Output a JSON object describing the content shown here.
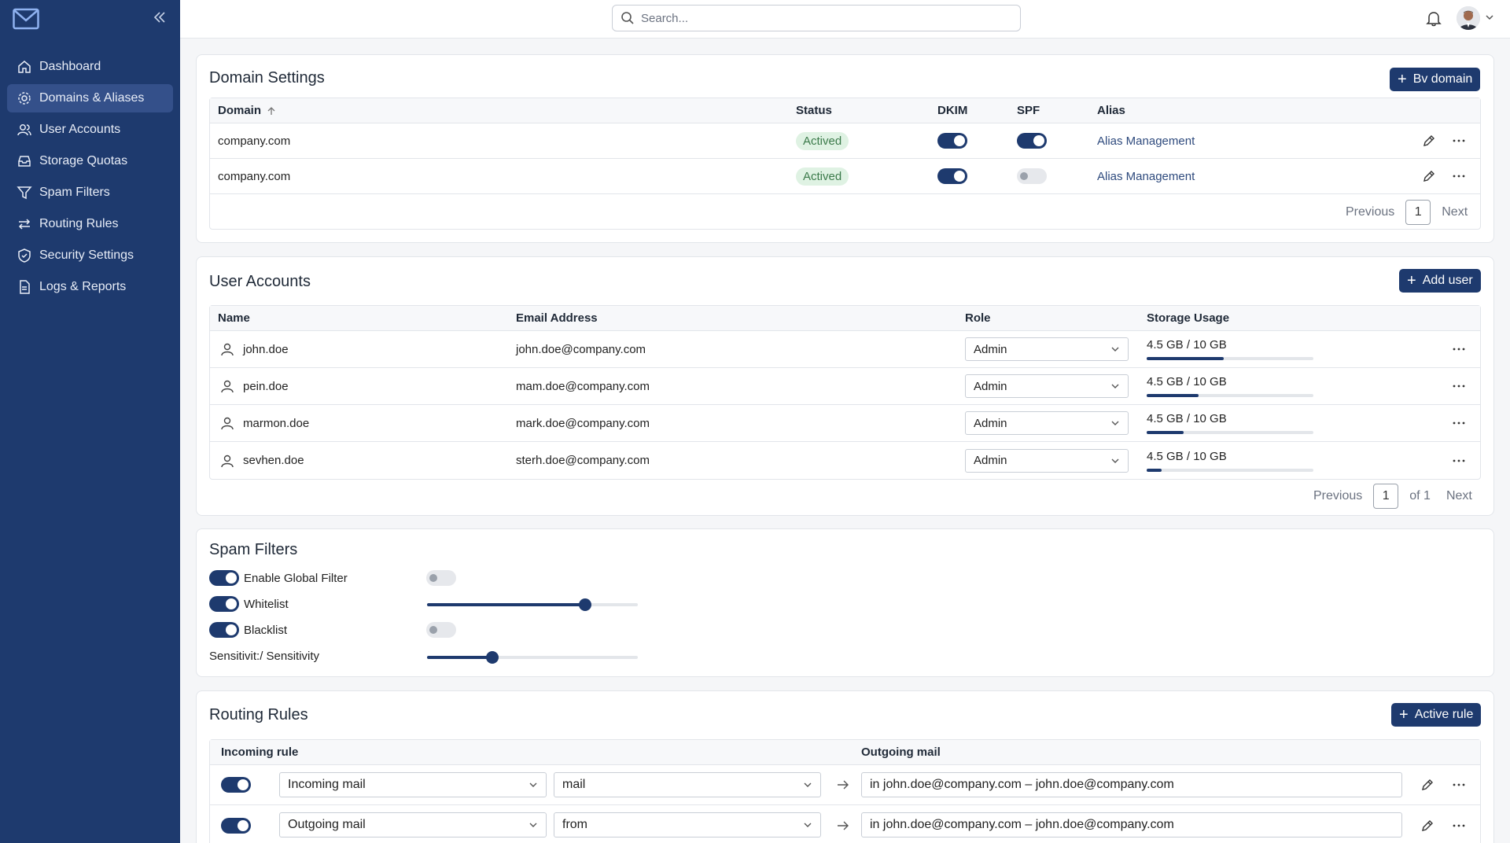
{
  "sidebar": {
    "items": [
      {
        "label": "Dashboard",
        "icon": "home-icon"
      },
      {
        "label": "Domains & Aliases",
        "icon": "gear-icon"
      },
      {
        "label": "User Accounts",
        "icon": "users-icon"
      },
      {
        "label": "Storage Quotas",
        "icon": "inbox-icon"
      },
      {
        "label": "Spam Filters",
        "icon": "filter-icon"
      },
      {
        "label": "Routing Rules",
        "icon": "arrows-icon"
      },
      {
        "label": "Security Settings",
        "icon": "shield-icon"
      },
      {
        "label": "Logs & Reports",
        "icon": "document-icon"
      }
    ],
    "active_index": 1
  },
  "topbar": {
    "search_placeholder": "Search..."
  },
  "domains": {
    "title": "Domain Settings",
    "add_button": "Bv domain",
    "headers": {
      "domain": "Domain",
      "status": "Status",
      "dkim": "DKIM",
      "spf": "SPF",
      "alias": "Alias"
    },
    "rows": [
      {
        "domain": "company.com",
        "status": "Actived",
        "dkim": true,
        "spf": true,
        "alias": "Alias Management"
      },
      {
        "domain": "company.com",
        "status": "Actived",
        "dkim": true,
        "spf": false,
        "alias": "Alias Management"
      }
    ],
    "pager": {
      "previous": "Previous",
      "page": "1",
      "next": "Next"
    }
  },
  "users": {
    "title": "User Accounts",
    "add_button": "Add user",
    "headers": {
      "name": "Name",
      "email": "Email Address",
      "role": "Role",
      "storage": "Storage Usage"
    },
    "rows": [
      {
        "name": "john.doe",
        "email": "john.doe@company.com",
        "role": "Admin",
        "storage": "4.5 GB / 10 GB",
        "usage": 0.46
      },
      {
        "name": "pein.doe",
        "email": "mam.doe@company.com",
        "role": "Admin",
        "storage": "4.5 GB / 10 GB",
        "usage": 0.31
      },
      {
        "name": "marmon.doe",
        "email": "mark.doe@company.com",
        "role": "Admin",
        "storage": "4.5 GB / 10 GB",
        "usage": 0.22
      },
      {
        "name": "sevhen.doe",
        "email": "sterh.doe@company.com",
        "role": "Admin",
        "storage": "4.5 GB / 10 GB",
        "usage": 0.09
      }
    ],
    "pager": {
      "previous": "Previous",
      "page": "1",
      "of": "of 1",
      "next": "Next"
    }
  },
  "spam": {
    "title": "Spam Filters",
    "items": [
      {
        "label": "Enable Global Filter",
        "on": true,
        "control": "toggle-off"
      },
      {
        "label": "Whitelist",
        "on": true,
        "control": "slider",
        "value": 0.75
      },
      {
        "label": "Blacklist",
        "on": true,
        "control": "toggle-off"
      }
    ],
    "sensitivity_label": "Sensitivit:/ Sensitivity",
    "sensitivity_value": 0.31
  },
  "routing": {
    "title": "Routing Rules",
    "add_button": "Active rule",
    "headers": {
      "incoming": "Incoming rule",
      "outgoing": "Outgoing mail"
    },
    "rows": [
      {
        "enabled": true,
        "type": "Incoming mail",
        "field": "mail",
        "target": "in john.doe@company.com – john.doe@company.com"
      },
      {
        "enabled": true,
        "type": "Outgoing mail",
        "field": "from",
        "target": "in john.doe@company.com – john.doe@company.com"
      }
    ]
  },
  "colors": {
    "accent": "#1e3a6e",
    "sidebar": "#1e3a6e",
    "badge_bg": "#dff2e3",
    "badge_text": "#3b7a4a"
  }
}
